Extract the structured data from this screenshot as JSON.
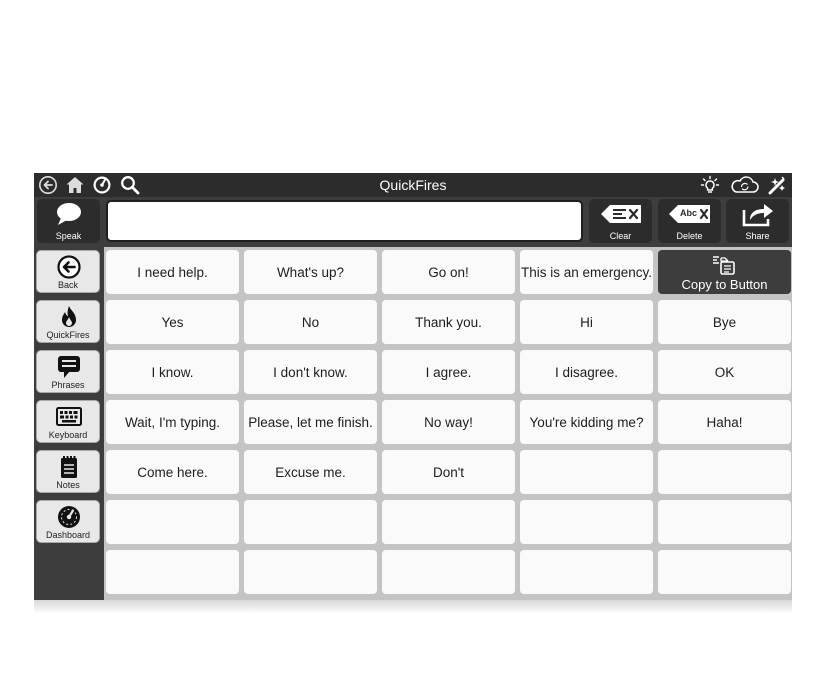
{
  "app": {
    "title": "QuickFires",
    "colors": {
      "titlebar": "#2c2c2c",
      "panel": "#3d3d3d",
      "cell": "#fafafa",
      "grid_background": "#c4c4c4"
    }
  },
  "titlebar": {
    "left_icons": [
      "back-circle-icon",
      "home-icon",
      "dashboard-icon",
      "search-icon"
    ],
    "right_icons": [
      "lightbulb-icon",
      "cloud-sync-icon",
      "edit-wand-icon"
    ]
  },
  "toolbar": {
    "speak_label": "Speak",
    "message_text": "",
    "clear_label": "Clear",
    "delete_label": "Delete",
    "delete_icon_text": "Abc",
    "share_label": "Share"
  },
  "sidebar": {
    "items": [
      {
        "label": "Back",
        "icon": "back-arrow-icon"
      },
      {
        "label": "QuickFires",
        "icon": "fire-icon"
      },
      {
        "label": "Phrases",
        "icon": "speech-bubble-icon"
      },
      {
        "label": "Keyboard",
        "icon": "keyboard-icon"
      },
      {
        "label": "Notes",
        "icon": "notepad-icon"
      },
      {
        "label": "Dashboard",
        "icon": "dashboard-icon"
      }
    ]
  },
  "grid": {
    "copy_button_label": "Copy to Button",
    "rows": [
      [
        "I need help.",
        "What's up?",
        "Go on!",
        "This is an emergency."
      ],
      [
        "Yes",
        "No",
        "Thank you.",
        "Hi",
        "Bye"
      ],
      [
        "I know.",
        "I don't know.",
        "I agree.",
        "I disagree.",
        "OK"
      ],
      [
        "Wait, I'm typing.",
        "Please, let me finish.",
        "No way!",
        "You're kidding me?",
        "Haha!"
      ],
      [
        "Come here.",
        "Excuse me.",
        "Don't",
        "",
        ""
      ],
      [
        "",
        "",
        "",
        "",
        ""
      ],
      [
        "",
        "",
        "",
        "",
        ""
      ]
    ]
  }
}
